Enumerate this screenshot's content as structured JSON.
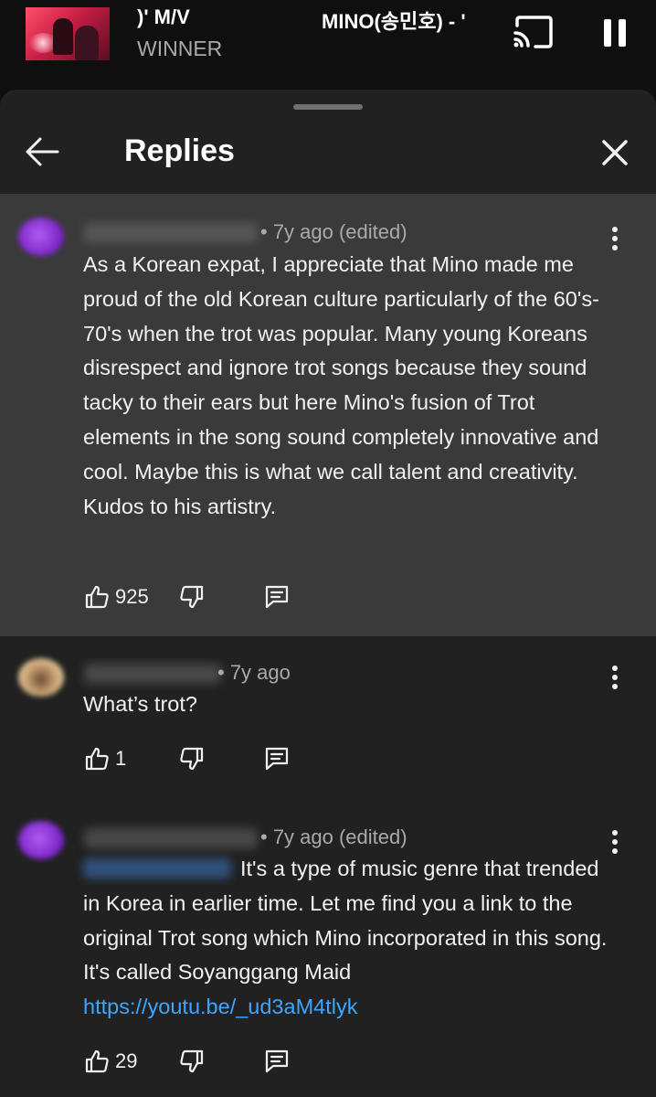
{
  "miniplayer": {
    "title_left": ")' M/V",
    "title_right": "MINO(송민호) - '",
    "artist": "WINNER"
  },
  "sheet": {
    "title": "Replies"
  },
  "comments": [
    {
      "meta": "• 7y ago (edited)",
      "text": "As a Korean expat, I appreciate that Mino made me proud of the old Korean culture particularly of the 60's-70's when the trot was popular. Many young Koreans disrespect and ignore trot songs because they sound tacky to their ears but here Mino's fusion of Trot elements in the song sound completely innovative and cool. Maybe this is what we call talent and creativity. Kudos to his artistry.",
      "likes": "925",
      "avatar_color": "#8a2be2"
    },
    {
      "meta": "• 7y ago",
      "text": "What’s trot?",
      "likes": "1",
      "avatar_color": "#a07850"
    },
    {
      "meta": "• 7y ago (edited)",
      "text": "It's a type of music genre that trended in Korea in earlier time. Let me find you a link to the original Trot song which Mino incorporated in this song. It's called Soyanggang Maid",
      "link": "https://youtu.be/_ud3aM4tlyk",
      "likes": "29",
      "avatar_color": "#8a2be2"
    }
  ],
  "colors": {
    "background": "#0f0f0f",
    "sheet": "#212121",
    "highlight": "#3a3a3a",
    "link": "#3ea6ff",
    "secondary_text": "#aaaaaa"
  },
  "icons": [
    "cast-icon",
    "pause-icon",
    "back-arrow-icon",
    "close-icon",
    "more-vert-icon",
    "thumbs-up-icon",
    "thumbs-down-icon",
    "reply-icon"
  ]
}
